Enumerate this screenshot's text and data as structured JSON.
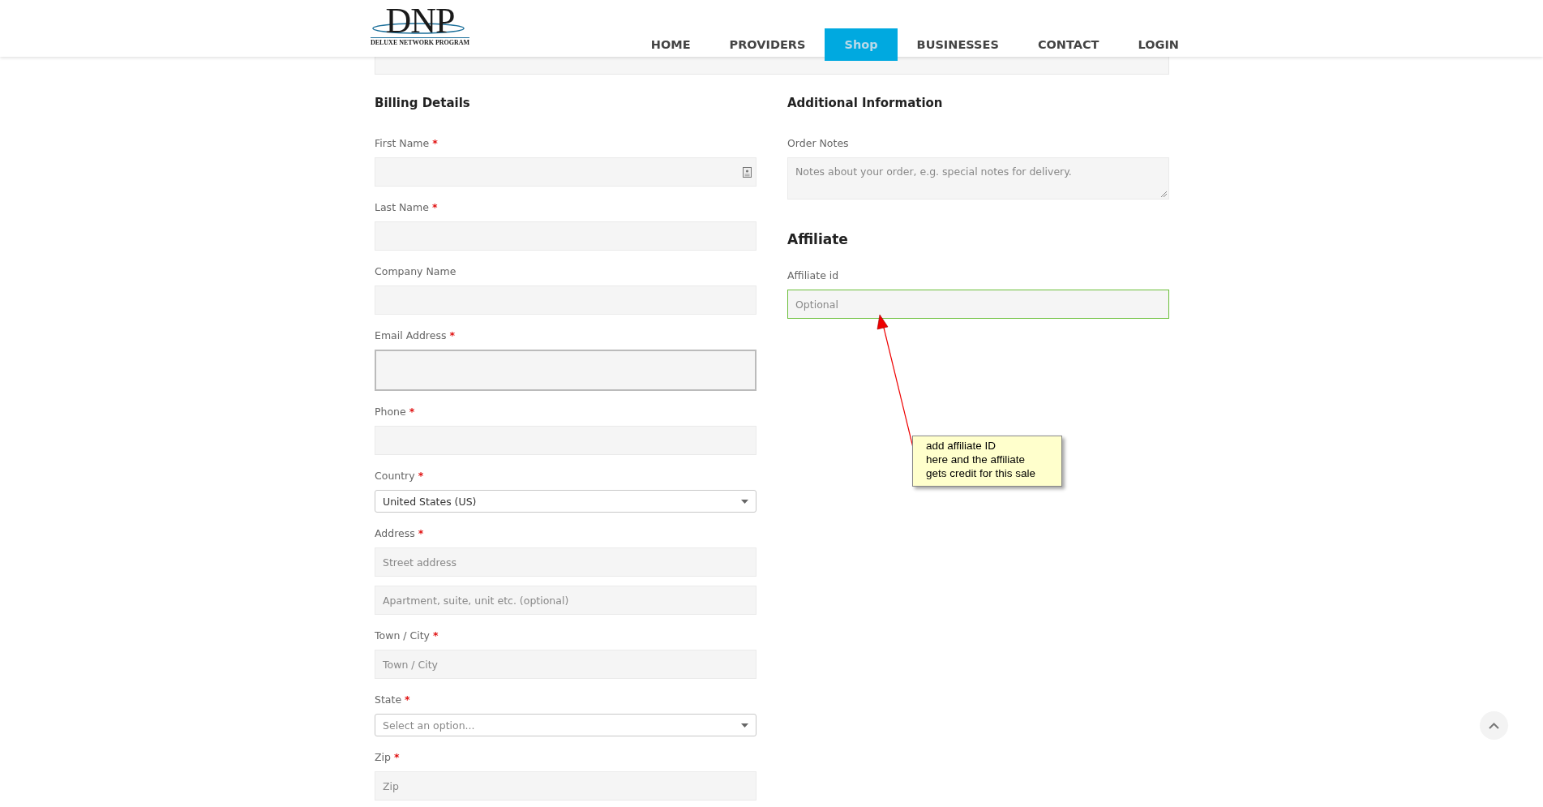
{
  "header": {
    "logo": {
      "title": "DNP",
      "subtitle": "DELUXE NETWORK PROGRAM"
    },
    "nav": [
      {
        "label": "HOME",
        "selected": false
      },
      {
        "label": "PROVIDERS",
        "selected": false
      },
      {
        "label": "Shop",
        "selected": true
      },
      {
        "label": "BUSINESSES",
        "selected": false
      },
      {
        "label": "CONTACT",
        "selected": false
      },
      {
        "label": "LOGIN",
        "selected": false
      }
    ]
  },
  "billing": {
    "title": "Billing Details",
    "fields": [
      {
        "label": "First Name",
        "required_mark": "*",
        "inputs": [
          {
            "kind": "text",
            "autofill_icon": true
          }
        ]
      },
      {
        "label": "Last Name",
        "required_mark": "*",
        "inputs": [
          {
            "kind": "text"
          }
        ]
      },
      {
        "label": "Company Name",
        "inputs": [
          {
            "kind": "text"
          }
        ]
      },
      {
        "label": "Email Address",
        "required_mark": "*",
        "inputs": [
          {
            "kind": "text",
            "focused": true
          }
        ]
      },
      {
        "label": "Phone",
        "required_mark": "*",
        "inputs": [
          {
            "kind": "text"
          }
        ]
      },
      {
        "label": "Country",
        "required_mark": "*",
        "inputs": [
          {
            "kind": "select",
            "value": "United States (US)"
          }
        ]
      },
      {
        "label": "Address",
        "required_mark": "*",
        "inputs": [
          {
            "kind": "text",
            "placeholder": "Street address"
          },
          {
            "kind": "text",
            "placeholder": "Apartment, suite, unit etc. (optional)"
          }
        ]
      },
      {
        "label": "Town / City",
        "required_mark": "*",
        "inputs": [
          {
            "kind": "text",
            "placeholder": "Town / City"
          }
        ]
      },
      {
        "label": "State",
        "required_mark": "*",
        "inputs": [
          {
            "kind": "select",
            "placeholder": "Select an option..."
          }
        ]
      },
      {
        "label": "Zip",
        "required_mark": "*",
        "inputs": [
          {
            "kind": "text",
            "placeholder": "Zip"
          }
        ]
      }
    ]
  },
  "additional": {
    "title": "Additional Information",
    "fields": [
      {
        "label": "Order Notes",
        "inputs": [
          {
            "kind": "textarea",
            "placeholder": "Notes about your order, e.g. special notes for delivery."
          }
        ]
      }
    ]
  },
  "affiliate": {
    "title": "Affiliate",
    "fields": [
      {
        "label": "Affiliate id",
        "inputs": [
          {
            "kind": "text",
            "placeholder": "Optional",
            "valid": true
          }
        ]
      }
    ]
  },
  "annotation": {
    "text": "add affiliate ID\nhere and the affiliate\ngets credit for this sale"
  }
}
